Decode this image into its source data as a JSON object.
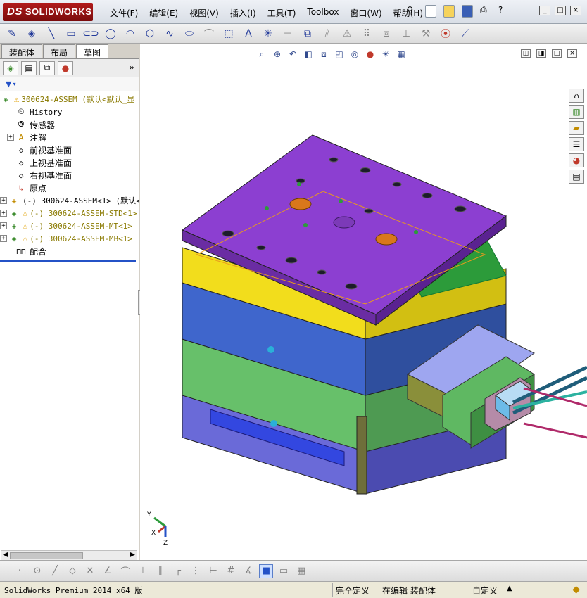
{
  "app": {
    "logo_prefix": "DS",
    "logo_text": "SOLIDWORKS"
  },
  "menu": [
    "文件(F)",
    "编辑(E)",
    "视图(V)",
    "插入(I)",
    "工具(T)",
    "Toolbox",
    "窗口(W)",
    "帮助(H)"
  ],
  "window_controls": [
    "_",
    "□",
    "×"
  ],
  "panel": {
    "tabs": [
      "装配体",
      "布局",
      "草图"
    ],
    "active_tab": "草图",
    "more": "»"
  },
  "tree": {
    "root": "300624-ASSEM (默认<默认_显",
    "items": [
      {
        "label": "History",
        "icon": "history-icon",
        "expand": false
      },
      {
        "label": "传感器",
        "icon": "sensor-icon",
        "expand": false
      },
      {
        "label": "注解",
        "icon": "annotation-icon",
        "expand": true
      },
      {
        "label": "前视基准面",
        "icon": "plane-icon",
        "expand": false
      },
      {
        "label": "上视基准面",
        "icon": "plane-icon",
        "expand": false
      },
      {
        "label": "右视基准面",
        "icon": "plane-icon",
        "expand": false
      },
      {
        "label": "原点",
        "icon": "origin-icon",
        "expand": false
      }
    ],
    "components": [
      {
        "label": "(-) 300624-ASSEM<1> (默认<",
        "warn": false
      },
      {
        "label": "(-) 300624-ASSEM-STD<1>",
        "warn": true
      },
      {
        "label": "(-) 300624-ASSEM-MT<1>",
        "warn": true
      },
      {
        "label": "(-) 300624-ASSEM-MB<1>",
        "warn": true
      }
    ],
    "mates": "配合"
  },
  "triad": {
    "x": "X",
    "y": "Y",
    "z": "Z"
  },
  "status": {
    "version": "SolidWorks Premium 2014 x64 版",
    "definition": "完全定义",
    "editing": "在编辑 装配体",
    "units": "自定义",
    "units_arrow": "▲"
  },
  "colors": {
    "accent": "#2452c7",
    "plate_top": "#8c3fd1",
    "cavity": "#f2dd1c",
    "core": "#3f66cc",
    "bplate": "#5fb862",
    "hot_runner": "#9ea6f0"
  }
}
